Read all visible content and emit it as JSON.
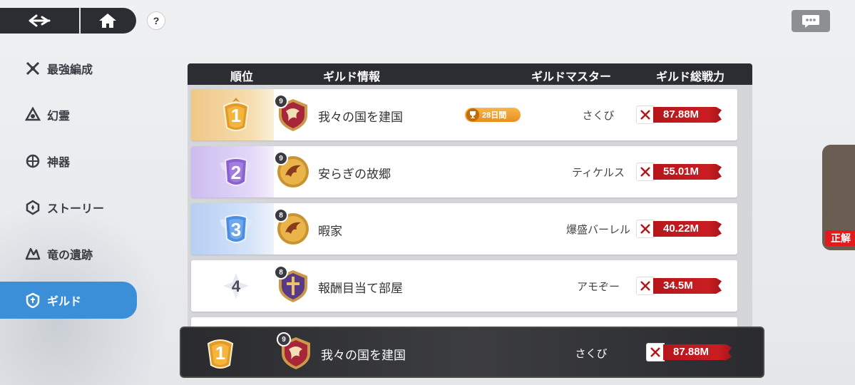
{
  "sidebar": {
    "items": [
      {
        "label": "最強編成",
        "icon": "crossed-swords-icon"
      },
      {
        "label": "幻霊",
        "icon": "spirit-icon"
      },
      {
        "label": "神器",
        "icon": "artifact-icon"
      },
      {
        "label": "ストーリー",
        "icon": "story-icon"
      },
      {
        "label": "竜の遺跡",
        "icon": "dragon-ruins-icon"
      },
      {
        "label": "ギルド",
        "icon": "guild-icon",
        "active": true
      }
    ]
  },
  "header": {
    "help": "?"
  },
  "table": {
    "columns": {
      "rank": "順位",
      "guild_info": "ギルド情報",
      "guild_master": "ギルドマスター",
      "total_power": "ギルド総戦力"
    },
    "rows": [
      {
        "rank": "1",
        "level": "9",
        "name": "我々の国を建国",
        "badge": "28日間",
        "master": "さくび",
        "power": "87.88M"
      },
      {
        "rank": "2",
        "level": "9",
        "name": "安らぎの故郷",
        "master": "ティケルス",
        "power": "55.01M"
      },
      {
        "rank": "3",
        "level": "8",
        "name": "暇家",
        "master": "爆盛バーレル",
        "power": "40.22M"
      },
      {
        "rank": "4",
        "level": "8",
        "name": "報酬目当て部屋",
        "master": "アモぞー",
        "power": "34.5M"
      }
    ]
  },
  "own_guild": {
    "rank": "1",
    "level": "9",
    "name": "我々の国を建国",
    "master": "さくび",
    "power": "87.88M"
  },
  "side_card": {
    "tag": "正解"
  },
  "colors": {
    "accent": "#3b8fd9",
    "power": "#c91e22",
    "gold": "#e9a93c",
    "purple": "#8f6bd6",
    "blue": "#5b9ae6"
  }
}
